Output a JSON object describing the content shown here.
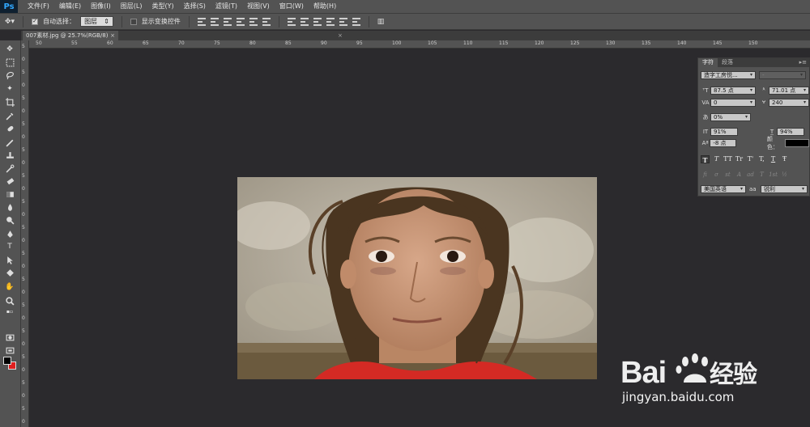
{
  "app": {
    "logo": "Ps"
  },
  "menubar": {
    "items": [
      "文件(F)",
      "编辑(E)",
      "图像(I)",
      "图层(L)",
      "类型(Y)",
      "选择(S)",
      "滤镜(T)",
      "视图(V)",
      "窗口(W)",
      "帮助(H)"
    ]
  },
  "options": {
    "auto_select_label": "自动选择：",
    "auto_select_checked": true,
    "auto_select_target": "图层",
    "show_transform_label": "显示变换控件",
    "show_transform_checked": false
  },
  "document": {
    "tab_title": "007素材.jpg @ 25.7%(RGB/8)",
    "close_glyph": "×"
  },
  "rulers": {
    "horizontal": [
      "50",
      "55",
      "60",
      "65",
      "70",
      "75",
      "80",
      "85",
      "90",
      "95",
      "100",
      "105",
      "110",
      "115",
      "120",
      "125",
      "130",
      "135",
      "140",
      "145",
      "150"
    ],
    "vertical": [
      "5",
      "0",
      "5",
      "0",
      "5",
      "0",
      "5",
      "0",
      "5",
      "0",
      "5",
      "0",
      "5",
      "0",
      "5",
      "0",
      "5",
      "0",
      "5",
      "0",
      "5",
      "0",
      "5",
      "0",
      "5",
      "0",
      "5",
      "0",
      "5",
      "0"
    ]
  },
  "character_panel": {
    "tabs": [
      "字符",
      "段落"
    ],
    "active_tab": "字符",
    "font_family": "造字工房悦...",
    "font_style": "-",
    "font_size": "87.5 点",
    "leading": "71.01 点",
    "kerning": "0",
    "tracking": "240",
    "tsume": "0%",
    "vertical_scale": "91%",
    "horizontal_scale": "94%",
    "baseline_shift": "-8 点",
    "color_label": "颜色：",
    "text_color": "#000000",
    "style_buttons": [
      "T",
      "T",
      "TT",
      "Tr",
      "T'",
      "T,",
      "T",
      "Ŧ"
    ],
    "opentype_buttons": [
      "fi",
      "σ",
      "st",
      "A",
      "ad",
      "T",
      "1st",
      "½"
    ],
    "language": "美国英语",
    "aa_label": "aa",
    "antialias": "锐利"
  },
  "colors": {
    "foreground": "#000000",
    "background": "#e02020",
    "accent": "#31a8ff"
  },
  "watermark": {
    "logo_text": "Bai du 经验",
    "url": "jingyan.baidu.com"
  }
}
